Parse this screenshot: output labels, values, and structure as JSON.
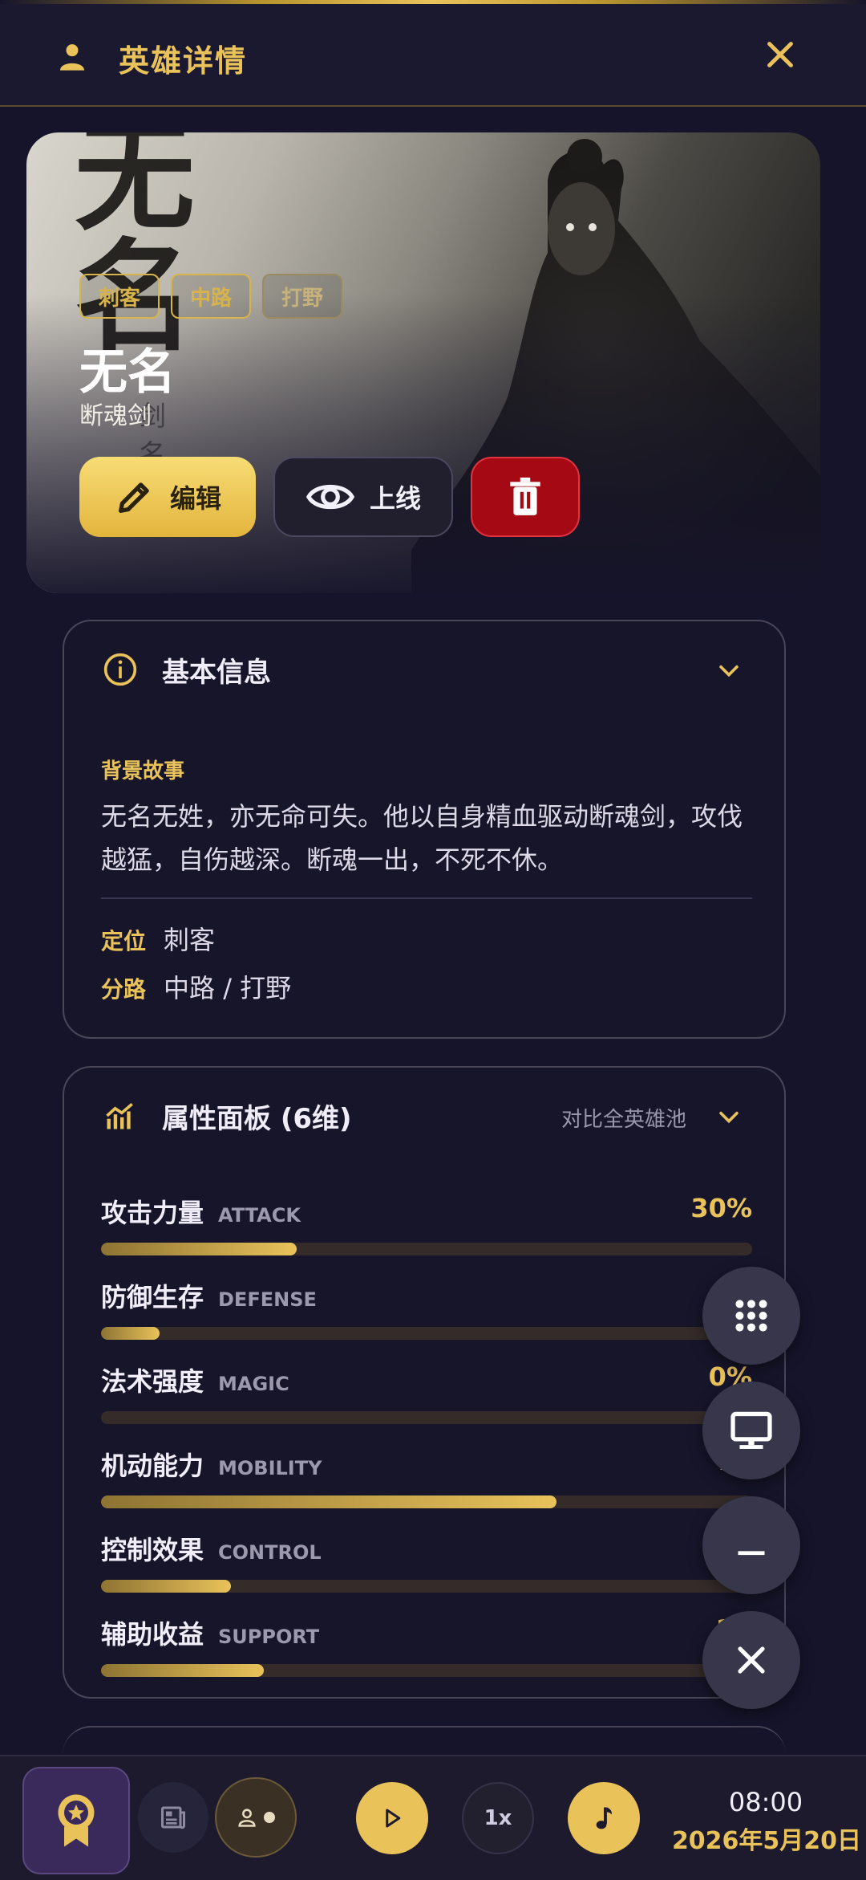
{
  "header": {
    "title": "英雄详情",
    "user_icon": "user-icon",
    "close_icon": "close-icon"
  },
  "hero": {
    "calligraphy_large": "无名",
    "calligraphy_small": "剑 名",
    "tags": [
      "刺客",
      "中路",
      "打野"
    ],
    "name": "无名",
    "subtitle": "断魂剑",
    "actions": {
      "edit": "编辑",
      "online": "上线"
    }
  },
  "basic_info": {
    "title": "基本信息",
    "story_label": "背景故事",
    "story": "无名无姓，亦无命可失。他以自身精血驱动断魂剑，攻伐越猛，自伤越深。断魂一出，不死不休。",
    "role_label": "定位",
    "role_value": "刺客",
    "lane_label": "分路",
    "lane_value": "中路 / 打野"
  },
  "attributes": {
    "title": "属性面板 (6维)",
    "compare": "对比全英雄池",
    "stats": [
      {
        "name": "攻击力量",
        "en": "ATTACK",
        "pct": "30%",
        "value": 0.3
      },
      {
        "name": "防御生存",
        "en": "DEFENSE",
        "pct": "",
        "value": 0.09
      },
      {
        "name": "法术强度",
        "en": "MAGIC",
        "pct": "0%",
        "value": 0.0
      },
      {
        "name": "机动能力",
        "en": "MOBILITY",
        "pct": "70",
        "value": 0.7
      },
      {
        "name": "控制效果",
        "en": "CONTROL",
        "pct": "2",
        "value": 0.2
      },
      {
        "name": "辅助收益",
        "en": "SUPPORT",
        "pct": "25",
        "value": 0.25
      }
    ]
  },
  "fabs": [
    "grid-icon",
    "monitor-icon",
    "minimize-icon",
    "close-icon"
  ],
  "bottombar": {
    "speed": "1x",
    "time": "08:00",
    "date": "2026年5月20日"
  },
  "colors": {
    "accent": "#e9c25a",
    "background": "#16142a",
    "danger": "#a50a14"
  }
}
